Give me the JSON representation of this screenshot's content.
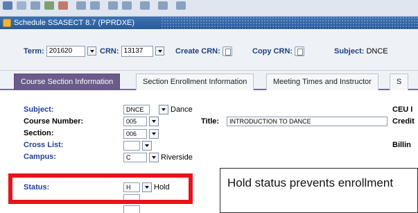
{
  "window": {
    "title": "Schedule  SSASECT 8.7  (PPRDXE)"
  },
  "key_block": {
    "term": {
      "label": "Term:",
      "value": "201620"
    },
    "crn": {
      "label": "CRN:",
      "value": "13137"
    },
    "create_crn": {
      "label": "Create CRN:"
    },
    "copy_crn": {
      "label": "Copy CRN:"
    },
    "subject": {
      "label": "Subject:",
      "value": "DNCE"
    }
  },
  "tabs": [
    {
      "label": "Course Section Information",
      "active": true
    },
    {
      "label": "Section Enrollment Information",
      "active": false
    },
    {
      "label": "Meeting Times and Instructor",
      "active": false
    },
    {
      "label": "S",
      "active": false
    }
  ],
  "form": {
    "subject": {
      "label": "Subject:",
      "code": "DNCE",
      "desc": "Dance"
    },
    "course_number": {
      "label": "Course Number:",
      "value": "005"
    },
    "title": {
      "label": "Title:",
      "value": "INTRODUCTION TO DANCE"
    },
    "section": {
      "label": "Section:",
      "value": "006"
    },
    "cross_list": {
      "label": "Cross List:"
    },
    "campus": {
      "label": "Campus:",
      "code": "C",
      "desc": "Riverside"
    },
    "status": {
      "label": "Status:",
      "code": "H",
      "desc": "Hold"
    },
    "right_col": {
      "ceu": "CEU I",
      "credit": "Credit",
      "billing": "Billin"
    }
  },
  "annotation": {
    "callout_text": "Hold status prevents enrollment"
  },
  "colors": {
    "highlight": "#e8131c",
    "active_tab": "#6b5b8a",
    "title_bar": "#2a5a96"
  }
}
